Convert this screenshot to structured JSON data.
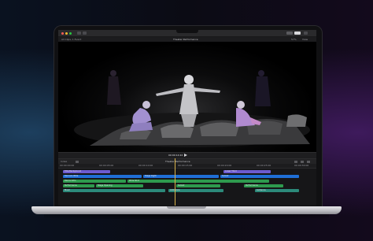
{
  "app": {
    "title": "Theater Performance",
    "library_label": "All Clips, 1 Event",
    "zoom": "57%",
    "view": "View",
    "timecode": "00:00:14:22"
  },
  "timeline": {
    "project_name": "Theater Performance",
    "index_label": "Index",
    "ruler_marks": [
      "00:00:00:00",
      "00:00:05:00",
      "00:00:10:00",
      "00:00:15:00",
      "00:00:20:00",
      "00:00:25:00",
      "00:00:30:00"
    ],
    "tracks": [
      {
        "clips": [
          {
            "label": "Title Background",
            "color": "#6d5bd0"
          },
          {
            "label": "Lower Third",
            "color": "#6d5bd0"
          }
        ]
      },
      {
        "clips": [
          {
            "label": "Dancers Wide",
            "color": "#1f6fd6"
          },
          {
            "label": "Stage Right",
            "color": "#1f6fd6"
          },
          {
            "label": "Soloist",
            "color": "#1f6fd6"
          }
        ]
      },
      {
        "clips": [
          {
            "label": "Dance Intro",
            "color": "#2e9a4e"
          },
          {
            "label": "Wide Shot",
            "color": "#2e9a4e"
          }
        ]
      },
      {
        "clips": [
          {
            "label": "Performance",
            "color": "#2e9a4e"
          },
          {
            "label": "Stage Opening",
            "color": "#2e9a4e"
          },
          {
            "label": "Soloist",
            "color": "#2e9a4e"
          },
          {
            "label": "Performance",
            "color": "#2e9a4e"
          }
        ]
      },
      {
        "clips": [
          {
            "label": "Music",
            "color": "#2c8a7a"
          },
          {
            "label": "Ambience",
            "color": "#2c8a7a"
          },
          {
            "label": "Audience",
            "color": "#2c8a7a"
          }
        ]
      }
    ]
  },
  "colors": {
    "playhead": "#d9b24a",
    "video_clip": "#1f6fd6",
    "title_clip": "#6d5bd0",
    "audio_clip": "#2e9a4e"
  },
  "icons": [
    "window-close-icon",
    "window-minimize-icon",
    "window-zoom-icon",
    "import-icon",
    "play-icon",
    "blade-tool-icon",
    "share-icon"
  ]
}
